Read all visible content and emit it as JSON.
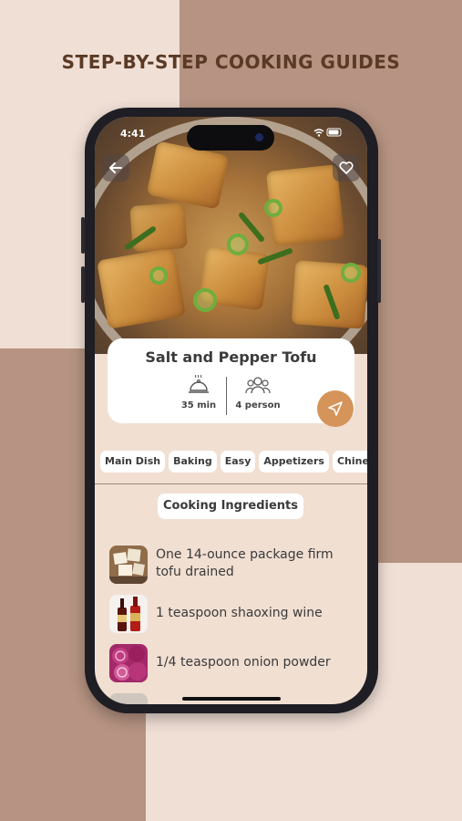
{
  "headline": "STEP-BY-STEP COOKING GUIDES",
  "status": {
    "time": "4:41"
  },
  "recipe": {
    "title": "Salt and Pepper Tofu",
    "time": "35 min",
    "servings": "4 person"
  },
  "tags": [
    "Main Dish",
    "Baking",
    "Easy",
    "Appetizers",
    "Chinese"
  ],
  "section_title": "Cooking Ingredients",
  "ingredients": [
    {
      "text": "One 14-ounce package firm tofu drained",
      "icon": "tofu-image"
    },
    {
      "text": "1 teaspoon shaoxing wine",
      "icon": "wine-bottles-image"
    },
    {
      "text": "1/4 teaspoon onion powder",
      "icon": "red-onion-image"
    }
  ],
  "colors": {
    "accent": "#d4945a",
    "background_light": "#f0dfd5",
    "background_dark": "#b69382",
    "headline": "#5a3a24"
  }
}
